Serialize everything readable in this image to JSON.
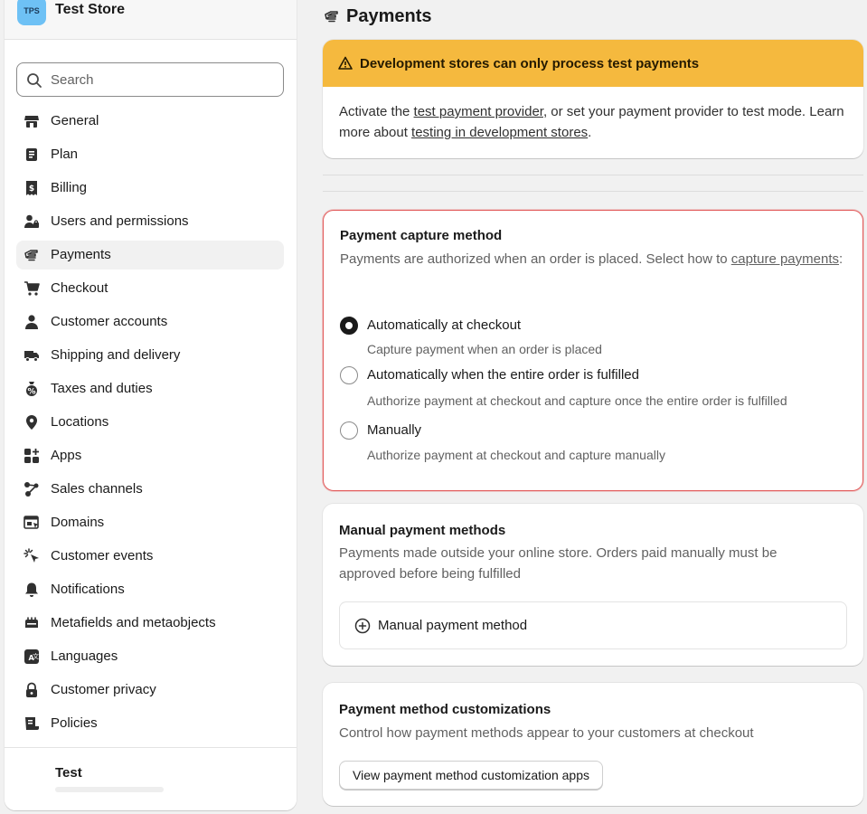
{
  "sidebar": {
    "store_logo": "TPS",
    "store_name": "Test Store",
    "search_placeholder": "Search",
    "items": [
      {
        "label": "General",
        "icon": "store-icon"
      },
      {
        "label": "Plan",
        "icon": "plan-icon"
      },
      {
        "label": "Billing",
        "icon": "billing-icon"
      },
      {
        "label": "Users and permissions",
        "icon": "users-icon"
      },
      {
        "label": "Payments",
        "icon": "payments-icon",
        "active": true
      },
      {
        "label": "Checkout",
        "icon": "cart-icon"
      },
      {
        "label": "Customer accounts",
        "icon": "person-icon"
      },
      {
        "label": "Shipping and delivery",
        "icon": "truck-icon"
      },
      {
        "label": "Taxes and duties",
        "icon": "tax-icon"
      },
      {
        "label": "Locations",
        "icon": "location-icon"
      },
      {
        "label": "Apps",
        "icon": "apps-icon"
      },
      {
        "label": "Sales channels",
        "icon": "channels-icon"
      },
      {
        "label": "Domains",
        "icon": "domains-icon"
      },
      {
        "label": "Customer events",
        "icon": "cursor-icon"
      },
      {
        "label": "Notifications",
        "icon": "bell-icon"
      },
      {
        "label": "Metafields and metaobjects",
        "icon": "metafields-icon"
      },
      {
        "label": "Languages",
        "icon": "languages-icon"
      },
      {
        "label": "Customer privacy",
        "icon": "lock-icon"
      },
      {
        "label": "Policies",
        "icon": "policies-icon"
      }
    ],
    "footer_user": "Test"
  },
  "page": {
    "title": "Payments"
  },
  "banner": {
    "title": "Development stores can only process test payments",
    "text_1": "Activate the ",
    "link_1": "test payment provider",
    "text_2": ", or set your payment provider to test mode. Learn more about ",
    "link_2": "testing in development stores",
    "text_3": "."
  },
  "capture": {
    "title": "Payment capture method",
    "desc_1": "Payments are authorized when an order is placed. Select how to ",
    "desc_link": "capture payments",
    "desc_2": ":",
    "options": [
      {
        "label": "Automatically at checkout",
        "help": "Capture payment when an order is placed",
        "checked": true
      },
      {
        "label": "Automatically when the entire order is fulfilled",
        "help": "Authorize payment at checkout and capture once the entire order is fulfilled",
        "checked": false
      },
      {
        "label": "Manually",
        "help": "Authorize payment at checkout and capture manually",
        "checked": false
      }
    ]
  },
  "manual": {
    "title": "Manual payment methods",
    "desc": "Payments made outside your online store. Orders paid manually must be approved before being fulfilled",
    "add_label": "Manual payment method"
  },
  "custom": {
    "title": "Payment method customizations",
    "desc": "Control how payment methods appear to your customers at checkout",
    "button": "View payment method customization apps"
  },
  "colors": {
    "banner_bg": "#f5b93e",
    "highlight_border": "#e25b5b",
    "store_logo_bg": "#6ec1f5"
  }
}
